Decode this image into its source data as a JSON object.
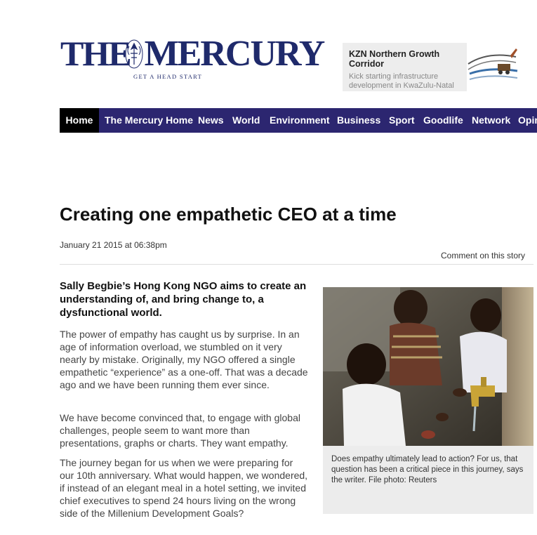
{
  "logo": {
    "title_the": "THE",
    "title_mercury": "MERCURY",
    "tagline": "GET A HEAD START"
  },
  "promo": {
    "title": "KZN Northern Growth Corridor",
    "subtitle": "Kick starting infrastructure development in KwaZulu-Natal"
  },
  "nav": {
    "items": [
      {
        "label": "Home",
        "active": true
      },
      {
        "label": "The Mercury Home"
      },
      {
        "label": "News"
      },
      {
        "label": "World"
      },
      {
        "label": "Environment"
      },
      {
        "label": "Business"
      },
      {
        "label": "Sport"
      },
      {
        "label": "Goodlife"
      },
      {
        "label": "Network"
      },
      {
        "label": "Opinion"
      }
    ]
  },
  "article": {
    "headline": "Creating one empathetic CEO at a time",
    "date": "January 21 2015 at 06:38pm",
    "comment_link": "Comment on this story",
    "intro": "Sally Begbie’s Hong Kong NGO aims to create an understanding of, and bring change to, a dysfunctional world.",
    "paragraphs": [
      "The power of empathy has caught us by surprise. In an age of information overload, we stumbled on it very nearly by mistake. Originally, my NGO offered a single empathetic “experience” as a one-off. That was a decade ago and we have been running them ever since.",
      "We have become convinced that, to engage with global challenges, people seem to want more than presentations, graphs or charts. They want empathy.",
      "The journey began for us when we were preparing for our 10th anniversary. What would happen, we wondered, if instead of an elegant meal in a hotel setting, we invited chief executives to spend 24 hours living on the wrong side of the Millenium Development Goals?"
    ],
    "photo_caption": "Does empathy ultimately lead to action? For us, that question has been a critical piece in this journey, says the writer. File photo: Reuters"
  },
  "colors": {
    "brand_navy": "#1f2a6b",
    "nav_bg": "#2c2670",
    "nav_active_bg": "#000000"
  }
}
